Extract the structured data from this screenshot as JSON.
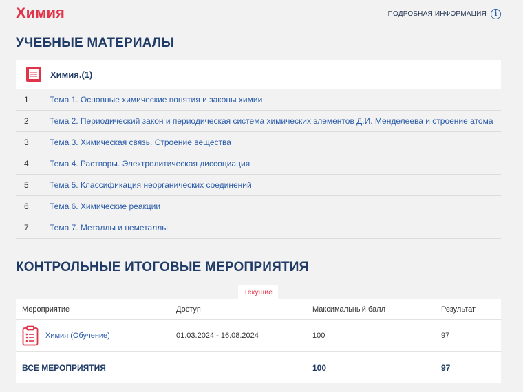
{
  "page": {
    "course_title": "Химия",
    "more_info_label": "ПОДРОБНАЯ ИНФОРМАЦИЯ",
    "info_icon_glyph": "i"
  },
  "materials": {
    "heading": "УЧЕБНЫЕ МАТЕРИАЛЫ",
    "card_label": "Химия.(1)",
    "card_icon": "book-icon",
    "topics": [
      {
        "num": "1",
        "title": "Тема 1. Основные химические понятия и законы химии"
      },
      {
        "num": "2",
        "title": "Тема 2. Периодический закон и периодическая система химических элементов Д.И. Менделеева и строение атома"
      },
      {
        "num": "3",
        "title": "Тема 3. Химическая связь. Строение вещества"
      },
      {
        "num": "4",
        "title": "Тема 4. Растворы. Электролитическая диссоциация"
      },
      {
        "num": "5",
        "title": "Тема 5. Классификация неорганических соединений"
      },
      {
        "num": "6",
        "title": "Тема 6. Химические реакции"
      },
      {
        "num": "7",
        "title": "Тема 7. Металлы и неметаллы"
      }
    ]
  },
  "events": {
    "heading": "КОНТРОЛЬНЫЕ ИТОГОВЫЕ МЕРОПРИЯТИЯ",
    "tab_current": "Текущие",
    "columns": [
      "Мероприятие",
      "Доступ",
      "Максимальный балл",
      "Результат"
    ],
    "rows": [
      {
        "name": "Химия (Обучение)",
        "access": "01.03.2024 - 16.08.2024",
        "max": "100",
        "result": "97",
        "icon": "clipboard-icon"
      }
    ],
    "total": {
      "label": "ВСЕ МЕРОПРИЯТИЯ",
      "max": "100",
      "result": "97"
    }
  },
  "colors": {
    "accent_red": "#e0344b",
    "navy": "#1f3b66",
    "link_blue": "#2a5ba8",
    "background": "#f2f2f2"
  }
}
